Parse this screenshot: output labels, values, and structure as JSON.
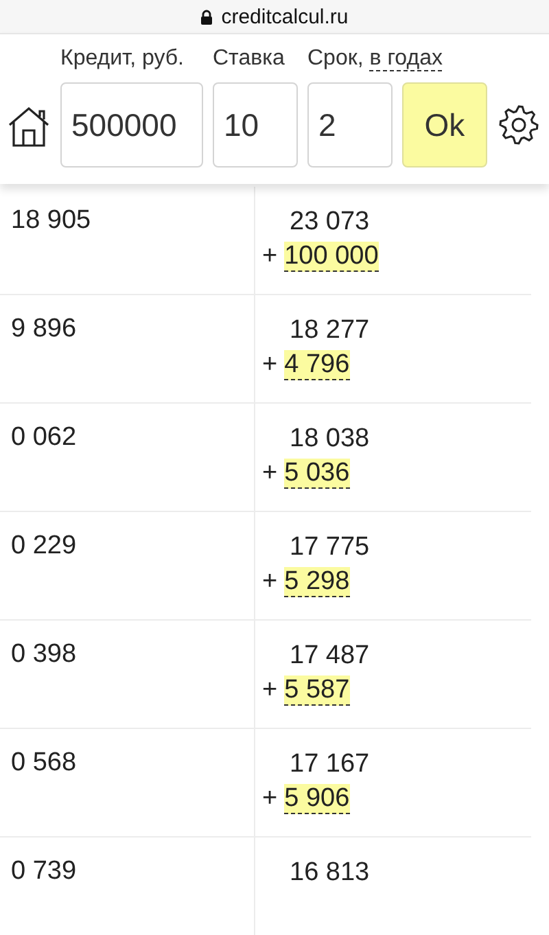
{
  "browser": {
    "url": "creditcalcul.ru"
  },
  "form": {
    "fields": [
      {
        "label": "Кредит, руб.",
        "value": "500000"
      },
      {
        "label": "Ставка",
        "value": "10"
      },
      {
        "label": "Срок,",
        "label_link": "в годах",
        "value": "2"
      }
    ],
    "submit": "Ok"
  },
  "rows": [
    {
      "column_1": "18 905",
      "column_2": "23 073",
      "sign": "+",
      "extra": "100 000"
    },
    {
      "column_1": "9 896",
      "column_2": "18 277",
      "sign": "+",
      "extra": "4 796"
    },
    {
      "column_1": "0 062",
      "column_2": "18 038",
      "sign": "+",
      "extra": "5 036"
    },
    {
      "column_1": "0 229",
      "column_2": "17 775",
      "sign": "+",
      "extra": "5 298"
    },
    {
      "column_1": "0 398",
      "column_2": "17 487",
      "sign": "+",
      "extra": "5 587"
    },
    {
      "column_1": "0 568",
      "column_2": "17 167",
      "sign": "+",
      "extra": "5 906"
    },
    {
      "column_1": "0 739",
      "column_2": "16 813"
    }
  ]
}
